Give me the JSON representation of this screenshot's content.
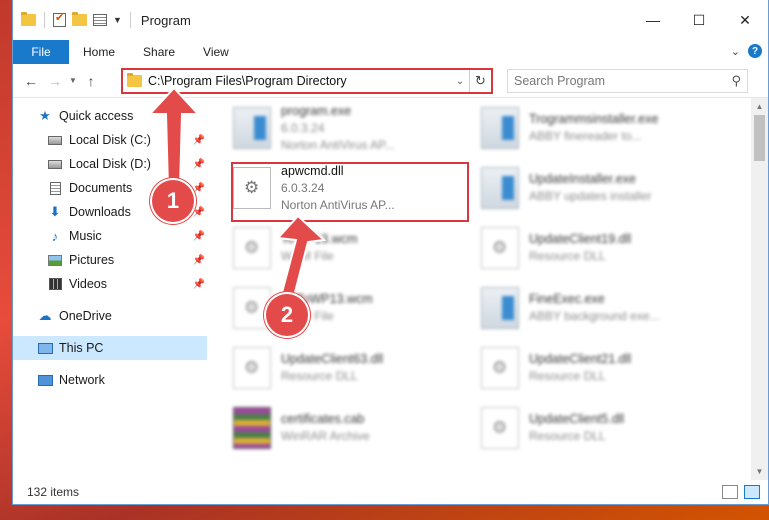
{
  "window": {
    "title": "Program",
    "controls": {
      "minimize": "—",
      "maximize": "☐",
      "close": "✕"
    }
  },
  "ribbon": {
    "tabs": [
      "File",
      "Home",
      "Share",
      "View"
    ],
    "help": "?"
  },
  "address": {
    "path": "C:\\Program Files\\Program Directory",
    "search_placeholder": "Search Program"
  },
  "nav": {
    "items": [
      {
        "label": "Quick access",
        "icon": "star-icon"
      },
      {
        "label": "Local Disk (C:)",
        "icon": "disk-icon",
        "pinned": true
      },
      {
        "label": "Local Disk (D:)",
        "icon": "disk-icon",
        "pinned": true
      },
      {
        "label": "Documents",
        "icon": "documents-icon",
        "pinned": true
      },
      {
        "label": "Downloads",
        "icon": "download-icon",
        "pinned": true
      },
      {
        "label": "Music",
        "icon": "music-icon",
        "pinned": true
      },
      {
        "label": "Pictures",
        "icon": "pictures-icon",
        "pinned": true
      },
      {
        "label": "Videos",
        "icon": "videos-icon",
        "pinned": true
      },
      {
        "label": "OneDrive",
        "icon": "cloud-icon"
      },
      {
        "label": "This PC",
        "icon": "computer-icon",
        "selected": true
      },
      {
        "label": "Network",
        "icon": "network-icon"
      }
    ]
  },
  "files": [
    {
      "name": "program.exe",
      "line2": "6.0.3.24",
      "line3": "Norton AntiVirus AP...",
      "type": "exe",
      "blurred": true
    },
    {
      "name": "Trogrammsinstaller.exe",
      "line2": "ABBY finereader to...",
      "type": "exe",
      "blurred": true
    },
    {
      "name": "apwcmd.dll",
      "line2": "6.0.3.24",
      "line3": "Norton AntiVirus AP...",
      "type": "dll",
      "blurred": false
    },
    {
      "name": "UpdateInstaller.exe",
      "line2": "ABBY updates installer",
      "type": "exe",
      "blurred": true
    },
    {
      "name": "ToWP13.wcm",
      "line2": "WCM File",
      "type": "dll",
      "blurred": true
    },
    {
      "name": "UpdateClient19.dll",
      "line2": "Resource DLL",
      "type": "dll",
      "blurred": true
    },
    {
      "name": "DitToWP13.wcm",
      "line2": "WCM File",
      "type": "dll",
      "blurred": true
    },
    {
      "name": "FineExec.exe",
      "line2": "ABBY background exe...",
      "type": "exe",
      "blurred": true
    },
    {
      "name": "UpdateClient63.dll",
      "line2": "Resource DLL",
      "type": "dll",
      "blurred": true
    },
    {
      "name": "UpdateClient21.dll",
      "line2": "Resource DLL",
      "type": "dll",
      "blurred": true
    },
    {
      "name": "certificates.cab",
      "line2": "WinRAR Archive",
      "type": "cab",
      "blurred": true
    },
    {
      "name": "UpdateClient5.dll",
      "line2": "Resource DLL",
      "type": "dll",
      "blurred": true
    }
  ],
  "status": {
    "item_count": "132 items"
  },
  "annotations": {
    "marker1": "1",
    "marker2": "2",
    "accent": "#e34b4b"
  }
}
